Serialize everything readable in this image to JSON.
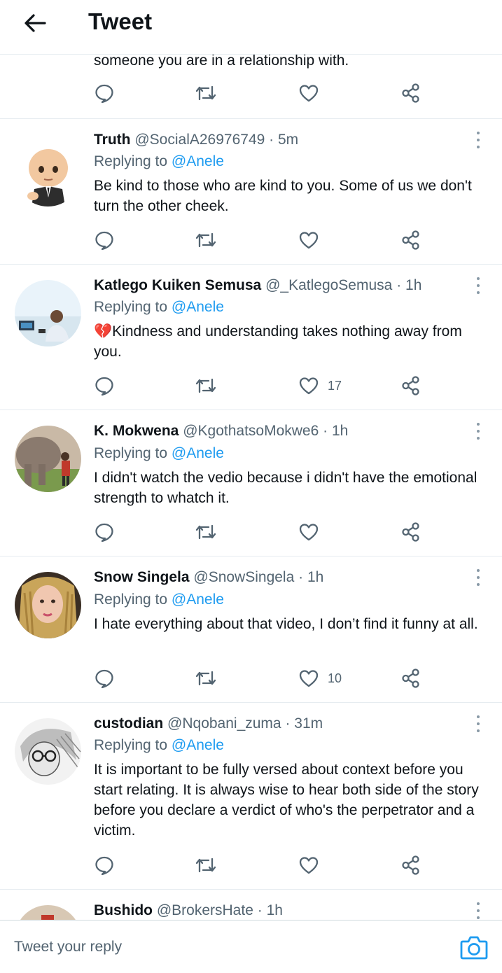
{
  "header": {
    "title": "Tweet",
    "back_icon": "arrow-left-icon"
  },
  "previous_tweet": {
    "text_tail": "someone you are in a relationship with."
  },
  "tweets": [
    {
      "name": "Truth",
      "handle": "@SocialA26976749",
      "separator": "·",
      "time": "5m",
      "replying_prefix": "Replying to ",
      "replying_to": "@Anele",
      "text": "Be kind to those who are kind to you. Some of us we don't turn the other cheek.",
      "likes": "",
      "avatar": "boss-baby-avatar"
    },
    {
      "name": "Katlego Kuiken Semusa",
      "handle": "@_KatlegoSemusa",
      "separator": "·",
      "time": "1h",
      "replying_prefix": "Replying to ",
      "replying_to": "@Anele",
      "emoji": "💔",
      "text": "Kindness and understanding takes nothing away from you.",
      "likes": "17",
      "avatar": "man-at-desk-avatar"
    },
    {
      "name": "K. Mokwena",
      "handle": "@KgothatsoMokwe6",
      "separator": "·",
      "time": "1h",
      "replying_prefix": "Replying to ",
      "replying_to": "@Anele",
      "text": "I didn't watch the vedio because i didn't have the emotional strength to whatch it.",
      "likes": "",
      "avatar": "elephant-avatar"
    },
    {
      "name": "Snow Singela",
      "handle": "@SnowSingela",
      "separator": "·",
      "time": "1h",
      "replying_prefix": "Replying to ",
      "replying_to": "@Anele",
      "text": "I hate everything about that video, I don’t find it funny at all.",
      "likes": "10",
      "avatar": "woman-braids-avatar"
    },
    {
      "name": "custodian",
      "handle": "@Nqobani_zuma",
      "separator": "·",
      "time": "31m",
      "replying_prefix": "Replying to ",
      "replying_to": "@Anele",
      "text": "It is important to be fully versed about context before you start relating. It is always wise to hear both side of the story before you declare a verdict of who's the perpetrator and a victim.",
      "likes": "",
      "avatar": "sketch-portrait-avatar"
    },
    {
      "name": "Bushido",
      "handle": "@BrokersHate",
      "separator": "·",
      "time": "1h",
      "avatar": "bushido-avatar"
    }
  ],
  "composer": {
    "placeholder": "Tweet your reply",
    "camera_icon": "camera-icon"
  },
  "colors": {
    "accent": "#1d9bf0",
    "secondary_text": "#536471",
    "primary_text": "#0f1419",
    "divider": "#e6ecf0"
  }
}
